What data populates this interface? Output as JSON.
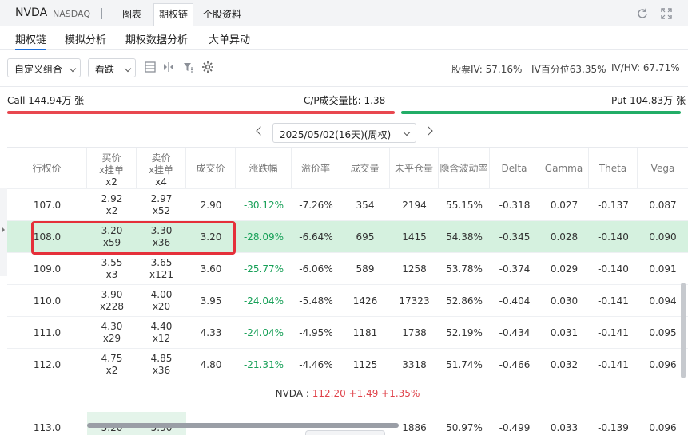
{
  "header": {
    "ticker": "NVDA",
    "exchange": "NASDAQ",
    "tabs": [
      "图表",
      "期权链",
      "个股资料"
    ]
  },
  "subtabs": [
    "期权链",
    "模拟分析",
    "期权数据分析",
    "大单异动"
  ],
  "toolbar": {
    "combo_label": "自定义组合",
    "direction_label": "看跌",
    "stock_iv": "股票IV: 57.16%",
    "iv_pct": "IV百分位63.35%",
    "iv_hv": "IV/HV: 67.71%"
  },
  "ratio": {
    "call": "Call 144.94万 张",
    "cp": "C/P成交量比: 1.38",
    "put": "Put 104.83万 张",
    "call_share": 0.58,
    "colors": {
      "call": "#e8474f",
      "put": "#22ad67"
    }
  },
  "expiry": "2025/05/02(16天)(周权)",
  "table": {
    "headers": {
      "strike": "行权价",
      "bid": [
        "买价",
        "x挂单"
      ],
      "ask": [
        "卖价",
        "x挂单"
      ],
      "last": "成交价",
      "change": "涨跌幅",
      "premium": "溢价率",
      "volume": "成交量",
      "oi": "未平仓量",
      "iv": "隐含波动率",
      "delta": "Delta",
      "gamma": "Gamma",
      "theta": "Theta",
      "vega": "Vega"
    },
    "partial_top": {
      "bid_size": "x2",
      "ask_size": "x4"
    },
    "rows": [
      {
        "strike": "107.0",
        "bid": "2.92",
        "bid_size": "x2",
        "ask": "2.97",
        "ask_size": "x52",
        "last": "2.90",
        "change": "-30.12%",
        "premium": "-7.26%",
        "volume": "354",
        "oi": "2194",
        "iv": "55.15%",
        "delta": "-0.318",
        "gamma": "0.027",
        "theta": "-0.137",
        "vega": "0.087"
      },
      {
        "strike": "108.0",
        "bid": "3.20",
        "bid_size": "x59",
        "ask": "3.30",
        "ask_size": "x36",
        "last": "3.20",
        "change": "-28.09%",
        "premium": "-6.64%",
        "volume": "695",
        "oi": "1415",
        "iv": "54.38%",
        "delta": "-0.345",
        "gamma": "0.028",
        "theta": "-0.140",
        "vega": "0.090"
      },
      {
        "strike": "109.0",
        "bid": "3.55",
        "bid_size": "x3",
        "ask": "3.65",
        "ask_size": "x121",
        "last": "3.60",
        "change": "-25.77%",
        "premium": "-6.06%",
        "volume": "589",
        "oi": "1258",
        "iv": "53.78%",
        "delta": "-0.374",
        "gamma": "0.029",
        "theta": "-0.140",
        "vega": "0.091"
      },
      {
        "strike": "110.0",
        "bid": "3.90",
        "bid_size": "x228",
        "ask": "4.00",
        "ask_size": "x20",
        "last": "3.95",
        "change": "-24.04%",
        "premium": "-5.48%",
        "volume": "1426",
        "oi": "17323",
        "iv": "52.86%",
        "delta": "-0.404",
        "gamma": "0.030",
        "theta": "-0.141",
        "vega": "0.094"
      },
      {
        "strike": "111.0",
        "bid": "4.30",
        "bid_size": "x29",
        "ask": "4.40",
        "ask_size": "x12",
        "last": "4.33",
        "change": "-24.04%",
        "premium": "-4.95%",
        "volume": "1181",
        "oi": "1738",
        "iv": "52.19%",
        "delta": "-0.434",
        "gamma": "0.031",
        "theta": "-0.141",
        "vega": "0.095"
      },
      {
        "strike": "112.0",
        "bid": "4.75",
        "bid_size": "x2",
        "ask": "4.85",
        "ask_size": "x36",
        "last": "4.80",
        "change": "-21.31%",
        "premium": "-4.46%",
        "volume": "1125",
        "oi": "3318",
        "iv": "51.74%",
        "delta": "-0.466",
        "gamma": "0.032",
        "theta": "-0.141",
        "vega": "0.096"
      }
    ],
    "spot": {
      "label": "NVDA :",
      "price": "112.20",
      "change": "+1.49",
      "pct": "+1.35%"
    },
    "partial_bottom": {
      "strike": "113.0",
      "bid": "5.20",
      "ask": "5.30",
      "oi": "1886",
      "iv": "50.97%",
      "delta": "-0.499",
      "gamma": "0.033",
      "theta": "-0.139",
      "vega": "0.096"
    }
  }
}
